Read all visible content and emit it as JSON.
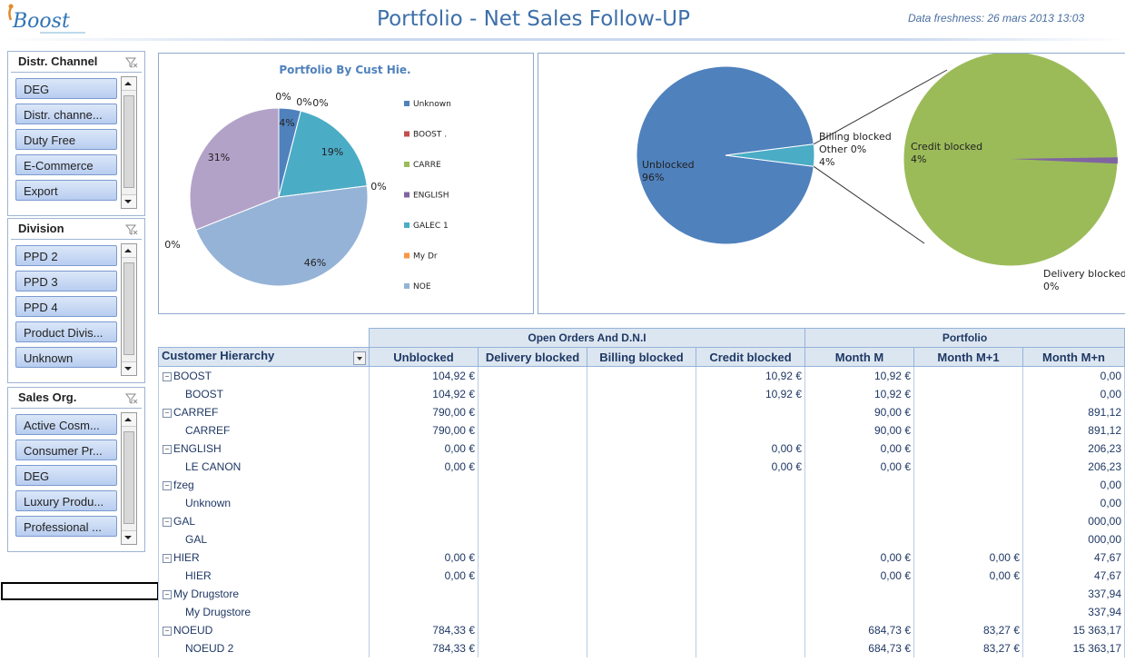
{
  "header": {
    "title": "Portfolio - Net Sales Follow-UP",
    "freshness": "Data freshness: 26 mars 2013 13:03",
    "logo_text": "Boost"
  },
  "slicers": [
    {
      "title": "Distr. Channel",
      "items": [
        "DEG",
        "Distr. channe...",
        "Duty Free",
        "E-Commerce",
        "Export"
      ]
    },
    {
      "title": "Division",
      "items": [
        "PPD 2",
        "PPD 3",
        "PPD 4",
        "Product Divis...",
        "Unknown"
      ]
    },
    {
      "title": "Sales Org.",
      "items": [
        "Active Cosm...",
        "Consumer Pr...",
        "DEG",
        "Luxury Produ...",
        "Professional ..."
      ]
    }
  ],
  "chart_data": [
    {
      "type": "pie",
      "title": "Portfolio By Cust Hie.",
      "categories": [
        "Unknown",
        "BOOST .",
        "CARRE",
        "ENGLISH",
        "GALEC 1",
        "My Dr",
        "NOE",
        "",
        ""
      ],
      "values": [
        4,
        0,
        0,
        0,
        19,
        0,
        46,
        0,
        31
      ],
      "labels": [
        "4%",
        "0%",
        "0%",
        "0%",
        "19%",
        "0%",
        "46%",
        "0%",
        "31%"
      ],
      "colors": [
        "#4f81bd",
        "#c0504d",
        "#9bbb59",
        "#8064a2",
        "#4bacc6",
        "#f79646",
        "#95b3d7",
        "#c4d79b",
        "#b3a2c7"
      ],
      "legend": [
        "Unknown",
        "BOOST .",
        "CARRE",
        "ENGLISH",
        "GALEC 1",
        "My Dr",
        "NOE"
      ],
      "legend_placement": "right"
    },
    {
      "type": "pie",
      "title": "",
      "main": {
        "categories": [
          "Unblocked",
          "Other"
        ],
        "values": [
          96,
          4
        ],
        "labels": [
          "Unblocked\n96%",
          "Billing blocked\nOther 0%\n4%"
        ],
        "colors": [
          "#4f81bd",
          "#4bacc6"
        ]
      },
      "secondary": {
        "categories": [
          "Credit blocked",
          "Delivery blocked"
        ],
        "values": [
          4,
          0
        ],
        "labels": [
          "Credit blocked\n4%",
          "Delivery blocked\n0%"
        ],
        "colors": [
          "#9bbb59",
          "#8064a2"
        ]
      }
    }
  ],
  "pivot": {
    "group_headers": [
      "Open Orders And D.N.I",
      "Portfolio"
    ],
    "columns": [
      "Customer Hierarchy",
      "Unblocked",
      "Delivery blocked",
      "Billing blocked",
      "Credit blocked",
      "Month M",
      "Month M+1",
      "Month M+n"
    ],
    "rows": [
      {
        "level": 0,
        "cells": [
          "BOOST",
          "104,92 €",
          "",
          "",
          "10,92 €",
          "10,92 €",
          "",
          "0,00"
        ]
      },
      {
        "level": 1,
        "cells": [
          "BOOST",
          "104,92 €",
          "",
          "",
          "10,92 €",
          "10,92 €",
          "",
          "0,00"
        ]
      },
      {
        "level": 0,
        "cells": [
          "CARREF",
          "790,00 €",
          "",
          "",
          "",
          "90,00 €",
          "",
          "891,12"
        ]
      },
      {
        "level": 1,
        "cells": [
          "CARREF",
          "790,00 €",
          "",
          "",
          "",
          "90,00 €",
          "",
          "891,12"
        ]
      },
      {
        "level": 0,
        "cells": [
          "ENGLISH",
          "0,00 €",
          "",
          "",
          "0,00 €",
          "0,00 €",
          "",
          "206,23"
        ]
      },
      {
        "level": 1,
        "cells": [
          "LE CANON",
          "0,00 €",
          "",
          "",
          "0,00 €",
          "0,00 €",
          "",
          "206,23"
        ]
      },
      {
        "level": 0,
        "cells": [
          "fzeg",
          "",
          "",
          "",
          "",
          "",
          "",
          "0,00"
        ]
      },
      {
        "level": 1,
        "cells": [
          "Unknown",
          "",
          "",
          "",
          "",
          "",
          "",
          "0,00"
        ]
      },
      {
        "level": 0,
        "cells": [
          "GAL",
          "",
          "",
          "",
          "",
          "",
          "",
          "000,00"
        ]
      },
      {
        "level": 1,
        "cells": [
          "GAL",
          "",
          "",
          "",
          "",
          "",
          "",
          "000,00"
        ]
      },
      {
        "level": 0,
        "cells": [
          "HIER",
          "0,00 €",
          "",
          "",
          "",
          "0,00 €",
          "0,00 €",
          "47,67"
        ]
      },
      {
        "level": 1,
        "cells": [
          "HIER",
          "0,00 €",
          "",
          "",
          "",
          "0,00 €",
          "0,00 €",
          "47,67"
        ]
      },
      {
        "level": 0,
        "cells": [
          "My Drugstore",
          "",
          "",
          "",
          "",
          "",
          "",
          "337,94"
        ]
      },
      {
        "level": 1,
        "cells": [
          "My Drugstore",
          "",
          "",
          "",
          "",
          "",
          "",
          "337,94"
        ]
      },
      {
        "level": 0,
        "cells": [
          "NOEUD",
          "784,33 €",
          "",
          "",
          "",
          "684,73 €",
          "83,27 €",
          "15 363,17"
        ]
      },
      {
        "level": 1,
        "cells": [
          "NOEUD 2",
          "784,33 €",
          "",
          "",
          "",
          "684,73 €",
          "83,27 €",
          "15 363,17"
        ]
      }
    ]
  }
}
